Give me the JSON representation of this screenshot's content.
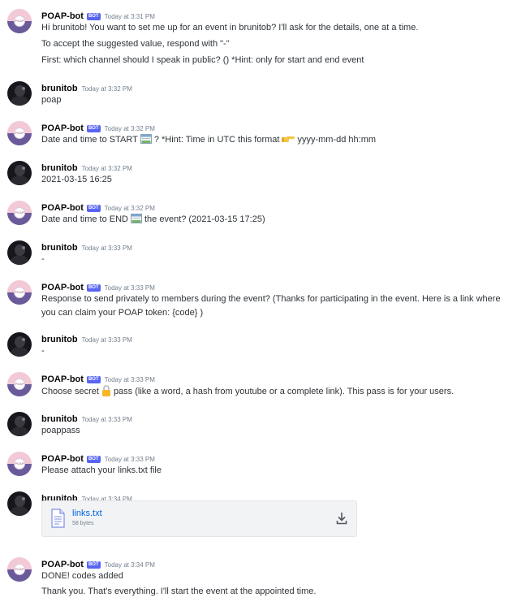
{
  "messages": [
    {
      "author": "POAP-bot",
      "bot": true,
      "bot_tag": "BOT",
      "time": "Today at 3:31 PM",
      "lines": [
        "Hi brunitob! You want to set me up for an event in brunitob? I'll ask for the details, one at a time.",
        "To accept the suggested value, respond with \"-\"",
        "First: which channel should I speak in public? () *Hint: only for start and end event"
      ]
    },
    {
      "author": "brunitob",
      "bot": false,
      "time": "Today at 3:32 PM",
      "lines": [
        "poap"
      ]
    },
    {
      "author": "POAP-bot",
      "bot": true,
      "bot_tag": "BOT",
      "time": "Today at 3:32 PM",
      "segments": [
        "Date and time to START",
        "? *Hint: Time in UTC this format",
        "yyyy-mm-dd hh:mm"
      ]
    },
    {
      "author": "brunitob",
      "bot": false,
      "time": "Today at 3:32 PM",
      "lines": [
        "2021-03-15 16:25"
      ]
    },
    {
      "author": "POAP-bot",
      "bot": true,
      "bot_tag": "BOT",
      "time": "Today at 3:32 PM",
      "segments": [
        "Date and time to END",
        "the event? (2021-03-15 17:25)"
      ]
    },
    {
      "author": "brunitob",
      "bot": false,
      "time": "Today at 3:33 PM",
      "lines": [
        "-"
      ]
    },
    {
      "author": "POAP-bot",
      "bot": true,
      "bot_tag": "BOT",
      "time": "Today at 3:33 PM",
      "lines": [
        "Response to send privately to members during the event? (Thanks for participating in the event. Here is a link where",
        "you can claim your POAP token: {code} )"
      ]
    },
    {
      "author": "brunitob",
      "bot": false,
      "time": "Today at 3:33 PM",
      "lines": [
        "-"
      ]
    },
    {
      "author": "POAP-bot",
      "bot": true,
      "bot_tag": "BOT",
      "time": "Today at 3:33 PM",
      "segments": [
        "Choose secret",
        "pass (like a word, a hash from youtube or a complete link). This pass is for your users."
      ]
    },
    {
      "author": "brunitob",
      "bot": false,
      "time": "Today at 3:33 PM",
      "lines": [
        "poappass"
      ]
    },
    {
      "author": "POAP-bot",
      "bot": true,
      "bot_tag": "BOT",
      "time": "Today at 3:33 PM",
      "lines": [
        "Please attach your links.txt file"
      ]
    },
    {
      "author": "brunitob",
      "bot": false,
      "time": "Today at 3:34 PM",
      "attachment": {
        "name": "links.txt",
        "size": "58 bytes"
      }
    },
    {
      "author": "POAP-bot",
      "bot": true,
      "bot_tag": "BOT",
      "time": "Today at 3:34 PM",
      "lines": [
        "DONE! codes added",
        "Thank you. That's everything. I'll start the event at the appointed time."
      ]
    }
  ],
  "icons": {
    "bot_avatar": "poap-logo-icon",
    "user_avatar": "user-photo-icon",
    "start_emoji": "calendar-icon",
    "end_emoji": "calendar-icon",
    "hint_emoji": "pointing-hand-icon",
    "secret_emoji": "lock-icon",
    "file": "document-icon",
    "download": "download-icon"
  },
  "colors": {
    "bot_tag": "#5865f2",
    "link": "#0068e0",
    "timestamp": "#747f8d"
  }
}
